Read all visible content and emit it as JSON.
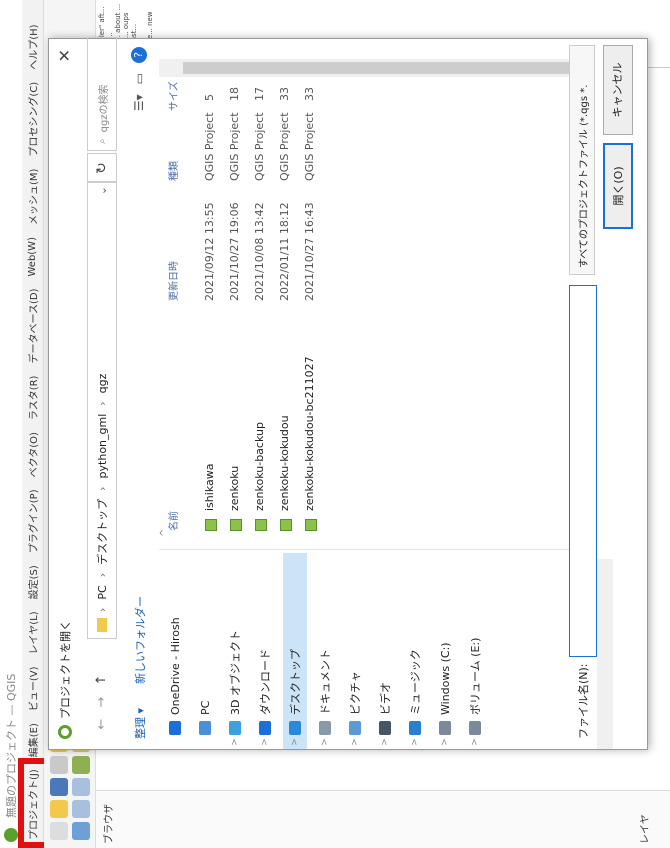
{
  "window": {
    "title": "無題のプロジェクト — QGIS"
  },
  "menubar": {
    "items": [
      "プロジェクト(J)",
      "編集(E)",
      "ビュー(V)",
      "レイヤ(L)",
      "設定(S)",
      "プラグイン(P)",
      "ベクタ(O)",
      "ラスタ(R)",
      "データベース(D)",
      "Web(W)",
      "メッシュ(M)",
      "プロセシング(C)",
      "ヘルプ(H)"
    ]
  },
  "left_panels": {
    "browser": "ブラウザ",
    "layers": "レイヤ"
  },
  "doc_strip_text": "you c... ler\" aft... making... screen... about ... ng arou... oups in... e last... users... undance... new",
  "dialog": {
    "title": "プロジェクトを開く",
    "close": "✕",
    "nav": {
      "back": "←",
      "forward": "→",
      "up": "↑"
    },
    "breadcrumb": [
      "PC",
      "デスクトップ",
      "python_gml",
      "qgz"
    ],
    "refresh": "↻",
    "search_placeholder": "qgzの検索",
    "commands": {
      "organize": "整理 ▾",
      "new_folder": "新しいフォルダー"
    },
    "sidebar": [
      {
        "label": "OneDrive - Hirosh",
        "icon": "cloud-icon",
        "color": "#1a6fd8",
        "arrow": ""
      },
      {
        "label": "PC",
        "icon": "pc-icon",
        "color": "#4a90d9",
        "arrow": ""
      },
      {
        "label": "3D オブジェクト",
        "icon": "cube-icon",
        "color": "#3aa0e0",
        "arrow": ">"
      },
      {
        "label": "ダウンロード",
        "icon": "download-icon",
        "color": "#1a6fd8",
        "arrow": ">"
      },
      {
        "label": "デスクトップ",
        "icon": "desktop-icon",
        "color": "#2a8ad8",
        "arrow": ">",
        "selected": true
      },
      {
        "label": "ドキュメント",
        "icon": "document-icon",
        "color": "#8899aa",
        "arrow": ">"
      },
      {
        "label": "ピクチャ",
        "icon": "picture-icon",
        "color": "#5b9bd5",
        "arrow": ">"
      },
      {
        "label": "ビデオ",
        "icon": "video-icon",
        "color": "#445566",
        "arrow": ">"
      },
      {
        "label": "ミュージック",
        "icon": "music-icon",
        "color": "#2a7fd0",
        "arrow": ">"
      },
      {
        "label": "Windows (C:)",
        "icon": "drive-icon",
        "color": "#7a8a9a",
        "arrow": ">"
      },
      {
        "label": "ボリューム (E:)",
        "icon": "drive-icon",
        "color": "#7a8a9a",
        "arrow": ">"
      }
    ],
    "columns": {
      "name": "名前",
      "date": "更新日時",
      "type": "種類",
      "size": "サイズ"
    },
    "files": [
      {
        "name": "ishikawa",
        "date": "2021/09/12 13:55",
        "type": "QGIS Project",
        "size": "5"
      },
      {
        "name": "zenkoku",
        "date": "2021/10/27 19:06",
        "type": "QGIS Project",
        "size": "18"
      },
      {
        "name": "zenkoku-backup",
        "date": "2021/10/08 13:42",
        "type": "QGIS Project",
        "size": "17"
      },
      {
        "name": "zenkoku-kokudou",
        "date": "2022/01/11 18:12",
        "type": "QGIS Project",
        "size": "33"
      },
      {
        "name": "zenkoku-kokudou-bc211027",
        "date": "2021/10/27 16:43",
        "type": "QGIS Project",
        "size": "33"
      }
    ],
    "filename_label": "ファイル名(N):",
    "filename_value": "",
    "filter": "すべてのプロジェクトファイル (*.qgs *.",
    "open_button": "開く(O)",
    "cancel_button": "キャンセル"
  }
}
